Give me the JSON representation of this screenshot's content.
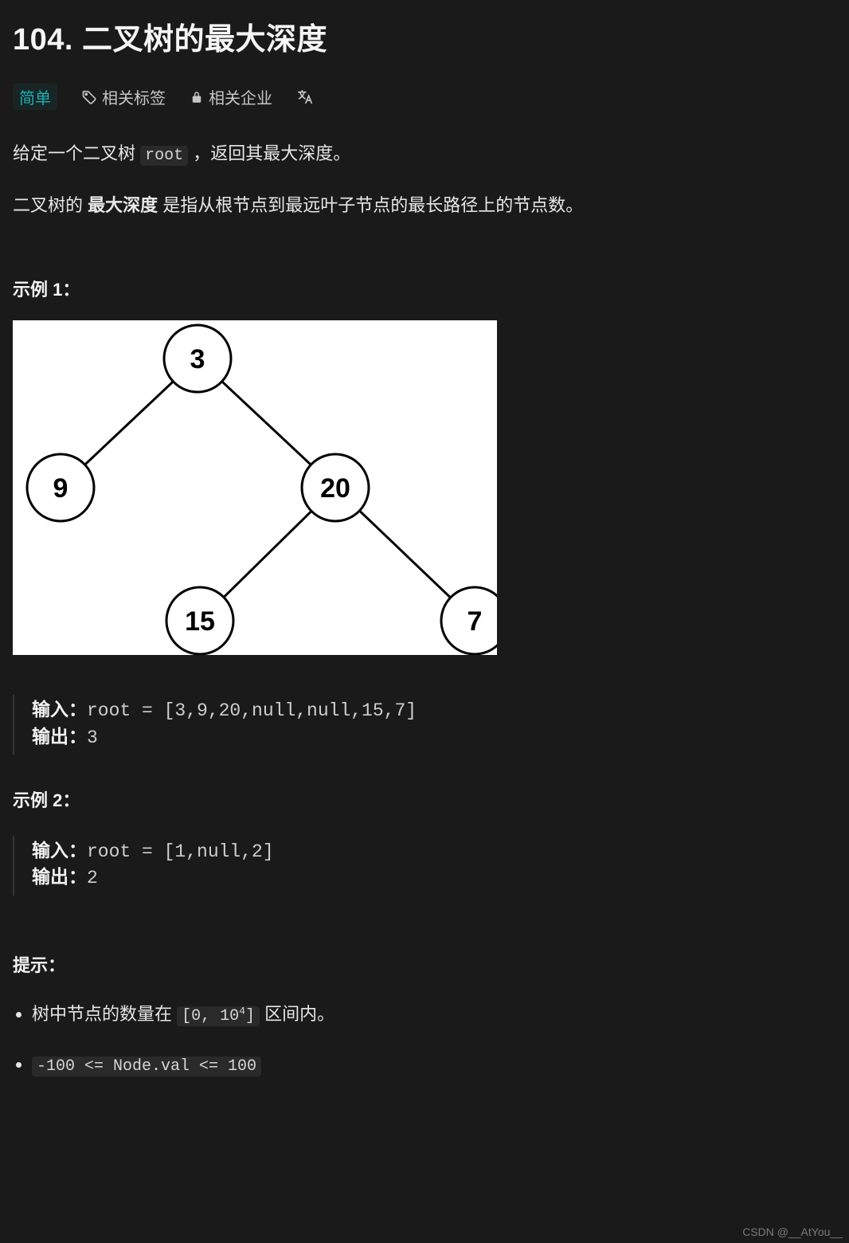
{
  "title": "104. 二叉树的最大深度",
  "tabs": {
    "easy": "简单",
    "tags": "相关标签",
    "companies": "相关企业"
  },
  "desc_prefix": "给定一个二叉树 ",
  "desc_code": "root",
  "desc_suffix": " ，返回其最大深度。",
  "para2_prefix": "二叉树的 ",
  "para2_bold": "最大深度",
  "para2_suffix": " 是指从根节点到最远叶子节点的最长路径上的节点数。",
  "example1_heading": "示例 1：",
  "tree_nodes": {
    "a": "3",
    "b": "9",
    "c": "20",
    "d": "15",
    "e": "7"
  },
  "io1_in_label": "输入：",
  "io1_in_val": "root = [3,9,20,null,null,15,7]",
  "io1_out_label": "输出：",
  "io1_out_val": "3",
  "example2_heading": "示例 2：",
  "io2_in_label": "输入：",
  "io2_in_val": "root = [1,null,2]",
  "io2_out_label": "输出：",
  "io2_out_val": "2",
  "hints_heading": "提示：",
  "hint1_prefix": "树中节点的数量在 ",
  "hint1_code_a": "[0, 10",
  "hint1_code_sup": "4",
  "hint1_code_b": "]",
  "hint1_suffix": " 区间内。",
  "hint2": "-100 <= Node.val <= 100",
  "watermark": "CSDN @__AtYou__"
}
